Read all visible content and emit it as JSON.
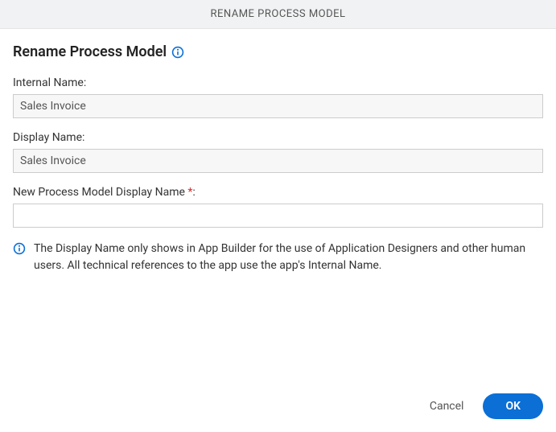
{
  "header": {
    "title": "RENAME PROCESS MODEL"
  },
  "dialog": {
    "title": "Rename Process Model",
    "info_icon": "info-icon"
  },
  "fields": {
    "internal_name": {
      "label": "Internal Name:",
      "value": "Sales Invoice"
    },
    "display_name": {
      "label": "Display Name:",
      "value": "Sales Invoice"
    },
    "new_display_name": {
      "label_prefix": "New Process Model Display Name ",
      "asterisk": "*",
      "label_suffix": ":",
      "value": "",
      "placeholder": ""
    }
  },
  "info_note": {
    "icon": "info-icon",
    "text": "The Display Name only shows in App Builder for the use of Application Designers and other human users. All technical references to the app use the app's Internal Name."
  },
  "footer": {
    "cancel_label": "Cancel",
    "ok_label": "OK"
  }
}
